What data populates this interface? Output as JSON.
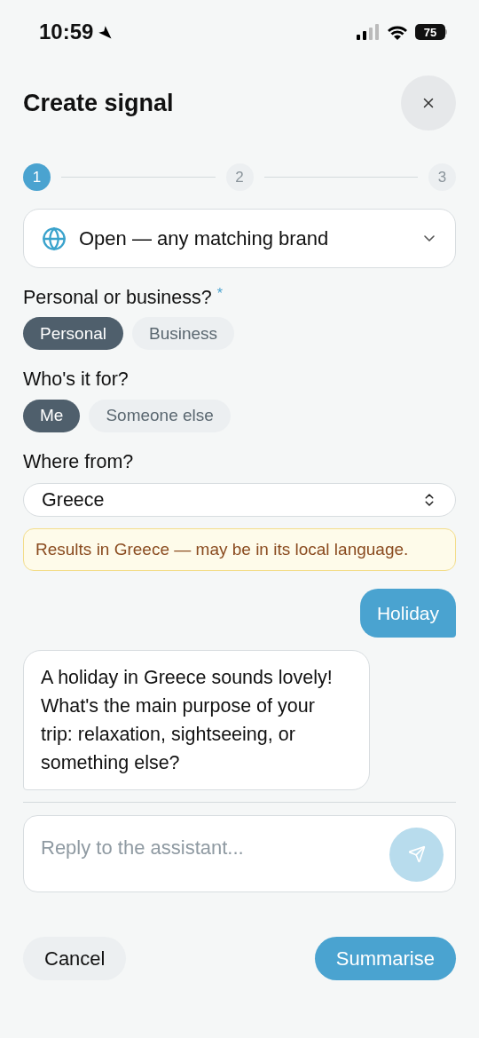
{
  "status_bar": {
    "time": "10:59",
    "battery": "75"
  },
  "title": "Create signal",
  "steps": [
    {
      "label": "1",
      "selected": true
    },
    {
      "label": "2",
      "selected": false
    },
    {
      "label": "3",
      "selected": false
    }
  ],
  "brand_dropdown": {
    "value": "Open — any matching brand"
  },
  "questions": [
    {
      "label": "Personal or business?",
      "required_mark": "*",
      "options": [
        {
          "label": "Personal",
          "selected": true
        },
        {
          "label": "Business",
          "selected": false
        }
      ]
    },
    {
      "label": "Who's it for?",
      "options": [
        {
          "label": "Me",
          "selected": true
        },
        {
          "label": "Someone else",
          "selected": false
        }
      ]
    }
  ],
  "location": {
    "label": "Where from?",
    "value": "Greece",
    "notice": "Results in Greece — may be in its local language."
  },
  "messages": [
    {
      "kind": "outgoing",
      "text": "Holiday"
    },
    {
      "kind": "incoming",
      "text": "A holiday in Greece sounds lovely! What's the main purpose of your trip: relaxation, sightseeing, or something else?"
    }
  ],
  "reply": {
    "placeholder": "Reply to the assistant..."
  },
  "actions": {
    "cancel": "Cancel",
    "submit": "Summarise"
  }
}
